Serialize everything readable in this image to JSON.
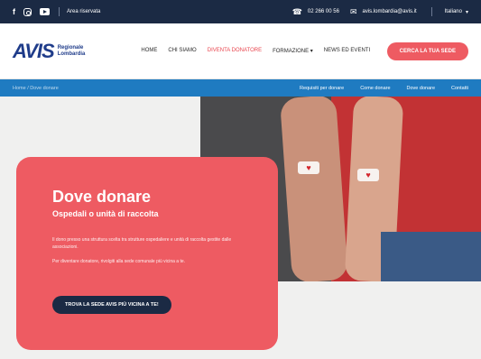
{
  "topbar": {
    "social_icons": [
      "facebook-icon",
      "instagram-icon",
      "youtube-icon"
    ],
    "privacy": "Area riservata",
    "phone": "02 266 00 56",
    "email": "avis.lombardia@avis.it",
    "language": "Italiano"
  },
  "header": {
    "logo_mark": "AVIS",
    "logo_line1": "Regionale",
    "logo_line2": "Lombardia",
    "nav": [
      "HOME",
      "CHI SIAMO",
      "DIVENTA DONATORE",
      "FORMAZIONE",
      "NEWS ED EVENTI"
    ],
    "active_nav": "DIVENTA DONATORE",
    "cta": "CERCA LA TUA SEDE"
  },
  "subnav": {
    "breadcrumb": "Home / Dove donare",
    "links": [
      "Requisiti per donare",
      "Come donare",
      "Dove donare",
      "Contatti"
    ]
  },
  "hero": {
    "title": "Dove donare",
    "subtitle": "Ospedali o unità di raccolta",
    "body": "Il dono presso una struttura scelta tra strutture ospedaliere e unità di raccolta gestite dalle associazioni.",
    "body2": "Per diventare donatore, rivolgiti alla sede comunale più vicina a te.",
    "button": "TROVA LA SEDE AVIS PIÙ VICINA A TE!"
  },
  "colors": {
    "dark_navy": "#1b2a44",
    "brand_blue": "#1f7bc1",
    "coral": "#ee5b62"
  }
}
